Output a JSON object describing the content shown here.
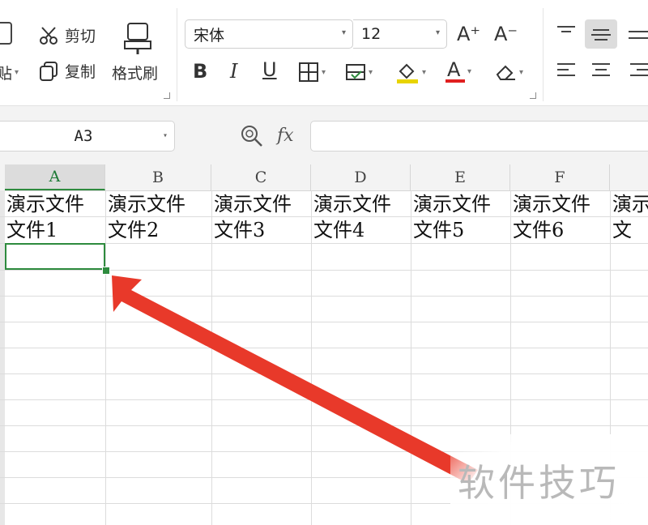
{
  "ribbon": {
    "paste_label": "贴",
    "cut_label": "剪切",
    "copy_label": "复制",
    "format_painter_label": "格式刷",
    "font_name": "宋体",
    "font_size": "12",
    "bold_glyph": "B",
    "italic_glyph": "I",
    "underline_glyph": "U",
    "font_color_glyph": "A",
    "grow_font_glyph": "A⁺",
    "shrink_font_glyph": "A⁻",
    "colors": {
      "font_color": "#e02020",
      "fill_color": "#e8d400",
      "accent_green": "#2e8b3e"
    }
  },
  "formula_bar": {
    "name_box": "A3",
    "fx_label": "fx",
    "formula_value": ""
  },
  "grid": {
    "columns": [
      "A",
      "B",
      "C",
      "D",
      "E",
      "F",
      ""
    ],
    "active_column": "A",
    "active_cell": "A3",
    "rows": [
      [
        "演示文件",
        "演示文件",
        "演示文件",
        "演示文件",
        "演示文件",
        "演示文件",
        "演示"
      ],
      [
        "文件1",
        "文件2",
        "文件3",
        "文件4",
        "文件5",
        "文件6",
        "文"
      ]
    ]
  },
  "annotation": {
    "arrow_color": "#e8392a"
  },
  "watermark": {
    "text": "软件技巧"
  }
}
